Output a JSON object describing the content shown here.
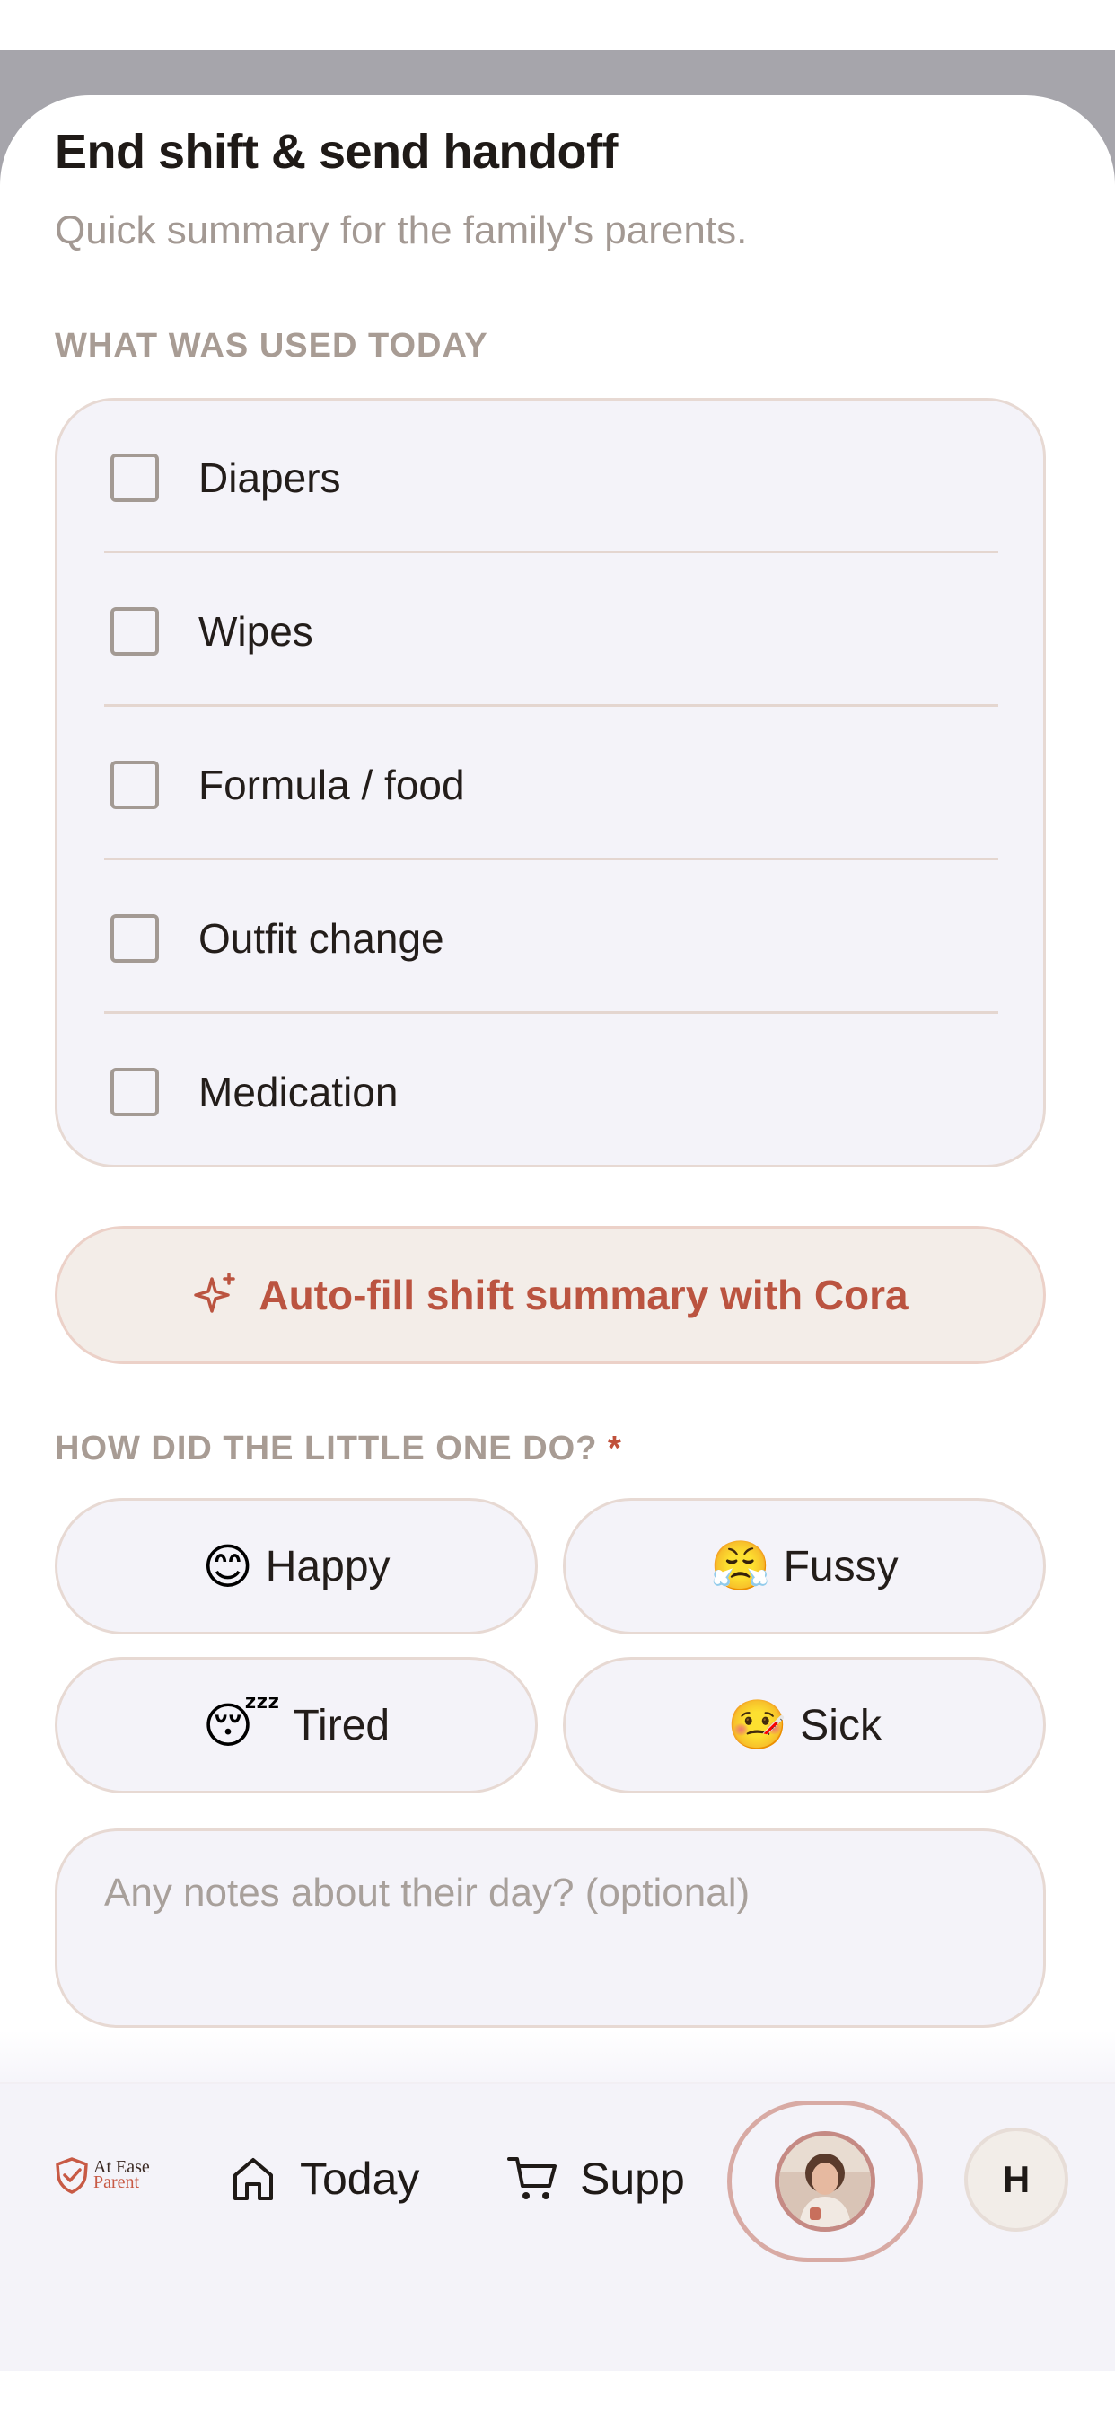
{
  "sheet": {
    "title": "End shift & send handoff",
    "subtitle": "Quick summary for the family's parents."
  },
  "used_today": {
    "label": "WHAT WAS USED TODAY",
    "items": [
      {
        "label": "Diapers",
        "checked": false
      },
      {
        "label": "Wipes",
        "checked": false
      },
      {
        "label": "Formula / food",
        "checked": false
      },
      {
        "label": "Outfit change",
        "checked": false
      },
      {
        "label": "Medication",
        "checked": false
      }
    ]
  },
  "autofill": {
    "label": "Auto-fill shift summary with Cora",
    "icon": "sparkle-icon",
    "color": "#bb5440"
  },
  "mood": {
    "label": "HOW DID THE LITTLE ONE DO?",
    "required_mark": "*",
    "options": [
      {
        "emoji": "😊",
        "label": "Happy"
      },
      {
        "emoji": "😤",
        "label": "Fussy"
      },
      {
        "emoji": "😴",
        "label": "Tired"
      },
      {
        "emoji": "🤒",
        "label": "Sick"
      }
    ]
  },
  "notes": {
    "placeholder": "Any notes about their day? (optional)"
  },
  "nav": {
    "logo_line1": "At Ease",
    "logo_line2": "Parent",
    "today": "Today",
    "supplies": "Supp",
    "profile_initial": "H"
  },
  "colors": {
    "accent": "#bb5440",
    "card_bg": "#f4f3f9",
    "border": "#e7d9d3"
  }
}
